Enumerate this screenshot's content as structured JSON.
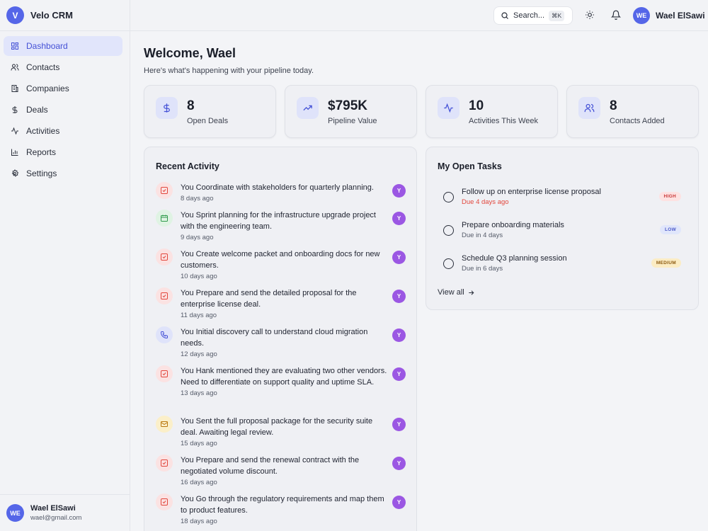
{
  "brand": {
    "logo_letter": "V",
    "name": "Velo CRM"
  },
  "nav": [
    {
      "label": "Dashboard",
      "icon": "dashboard-icon",
      "active": true
    },
    {
      "label": "Contacts",
      "icon": "contacts-icon",
      "active": false
    },
    {
      "label": "Companies",
      "icon": "companies-icon",
      "active": false
    },
    {
      "label": "Deals",
      "icon": "dollar-icon",
      "active": false
    },
    {
      "label": "Activities",
      "icon": "activity-icon",
      "active": false
    },
    {
      "label": "Reports",
      "icon": "reports-icon",
      "active": false
    },
    {
      "label": "Settings",
      "icon": "settings-icon",
      "active": false
    }
  ],
  "user": {
    "initials": "WE",
    "name": "Wael ElSawi",
    "email": "wael@gmail.com"
  },
  "topbar": {
    "search_placeholder": "Search...",
    "search_shortcut": "⌘K"
  },
  "main": {
    "welcome": "Welcome, Wael",
    "subtitle": "Here's what's happening with your pipeline today."
  },
  "stats": [
    {
      "value": "8",
      "label": "Open Deals",
      "icon": "dollar-icon"
    },
    {
      "value": "$795K",
      "label": "Pipeline Value",
      "icon": "trending-up-icon"
    },
    {
      "value": "10",
      "label": "Activities This Week",
      "icon": "activity-icon"
    },
    {
      "value": "8",
      "label": "Contacts Added",
      "icon": "users-icon"
    }
  ],
  "recent_activity": {
    "title": "Recent Activity",
    "items": [
      {
        "text": "You Coordinate with stakeholders for quarterly planning.",
        "time": "8 days ago",
        "icon": "task-icon",
        "avatar": "Y"
      },
      {
        "text": "You Sprint planning for the infrastructure upgrade project with the engineering team.",
        "time": "9 days ago",
        "icon": "calendar-icon",
        "avatar": "Y"
      },
      {
        "text": "You Create welcome packet and onboarding docs for new customers.",
        "time": "10 days ago",
        "icon": "task-icon",
        "avatar": "Y"
      },
      {
        "text": "You Prepare and send the detailed proposal for the enterprise license deal.",
        "time": "11 days ago",
        "icon": "task-icon",
        "avatar": "Y"
      },
      {
        "text": "You Initial discovery call to understand cloud migration needs.",
        "time": "12 days ago",
        "icon": "phone-icon",
        "avatar": "Y"
      },
      {
        "text": "You Hank mentioned they are evaluating two other vendors. Need to differentiate on support quality and uptime SLA.",
        "time": "13 days ago",
        "icon": "task-icon",
        "avatar": "Y"
      },
      {
        "text": "You Sent the full proposal package for the security suite deal. Awaiting legal review.",
        "time": "15 days ago",
        "icon": "mail-icon",
        "avatar": "Y"
      },
      {
        "text": "You Prepare and send the renewal contract with the negotiated volume discount.",
        "time": "16 days ago",
        "icon": "task-icon",
        "avatar": "Y"
      },
      {
        "text": "You Go through the regulatory requirements and map them to product features.",
        "time": "18 days ago",
        "icon": "task-icon",
        "avatar": "Y"
      }
    ]
  },
  "tasks": {
    "title": "My Open Tasks",
    "items": [
      {
        "title": "Follow up on enterprise license proposal",
        "due": "Due 4 days ago",
        "overdue": true,
        "priority": "HIGH"
      },
      {
        "title": "Prepare onboarding materials",
        "due": "Due in 4 days",
        "overdue": false,
        "priority": "LOW"
      },
      {
        "title": "Schedule Q3 planning session",
        "due": "Due in 6 days",
        "overdue": false,
        "priority": "MEDIUM"
      }
    ],
    "view_all": "View all"
  },
  "colors": {
    "accent": "#5566e8",
    "active_nav_bg": "#e1e5fb",
    "avatar_purple": "#9b57e3",
    "overdue_red": "#e2473d",
    "high_bg": "#fde2e2",
    "high_fg": "#c93a3a",
    "low_bg": "#e0e6fb",
    "low_fg": "#4c5ac9",
    "medium_bg": "#fbecc4",
    "medium_fg": "#8c5a10"
  }
}
